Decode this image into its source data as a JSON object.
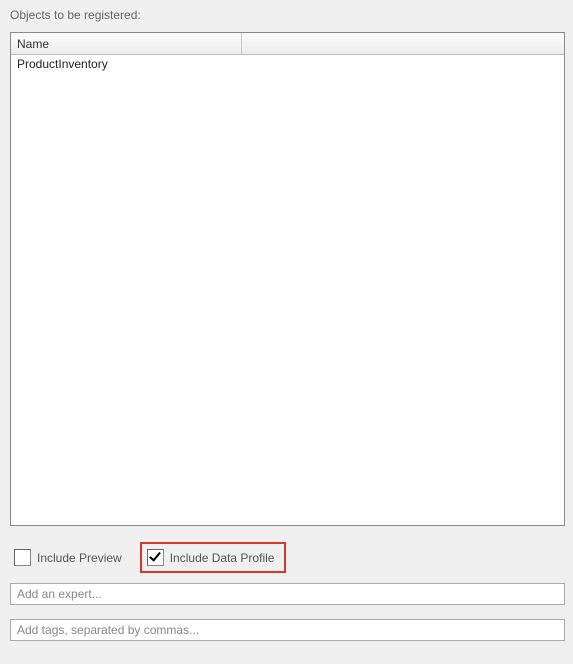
{
  "section_label": "Objects to be registered:",
  "table": {
    "columns": {
      "name": "Name"
    },
    "rows": [
      {
        "name": "ProductInventory"
      }
    ]
  },
  "checkboxes": {
    "include_preview": {
      "label": "Include Preview",
      "checked": false
    },
    "include_data_profile": {
      "label": "Include Data Profile",
      "checked": true
    }
  },
  "inputs": {
    "expert": {
      "placeholder": "Add an expert...",
      "value": ""
    },
    "tags": {
      "placeholder": "Add tags, separated by commas...",
      "value": ""
    }
  }
}
